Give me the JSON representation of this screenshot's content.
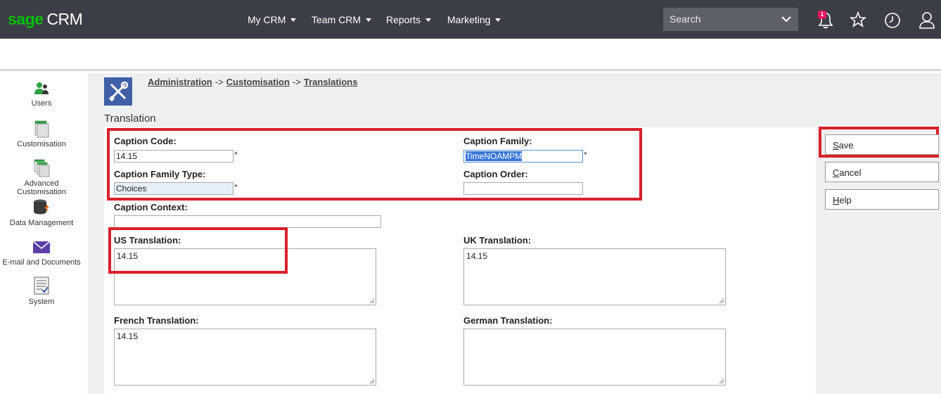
{
  "header": {
    "logo_sage": "sage",
    "logo_crm": "CRM",
    "nav": [
      {
        "label": "My CRM"
      },
      {
        "label": "Team CRM"
      },
      {
        "label": "Reports"
      },
      {
        "label": "Marketing"
      }
    ],
    "search_label": "Search",
    "notification_count": "1"
  },
  "sidebar": {
    "items": [
      {
        "label": "Users"
      },
      {
        "label": "Customisation"
      },
      {
        "label": "Advanced Customisation"
      },
      {
        "label": "Data Management"
      },
      {
        "label": "E-mail and Documents"
      },
      {
        "label": "System"
      }
    ]
  },
  "breadcrumb": {
    "items": [
      "Administration",
      "Customisation",
      "Translations"
    ],
    "separator": "->"
  },
  "section_title": "Translation",
  "form": {
    "caption_code": {
      "label": "Caption Code:",
      "value": "14.15"
    },
    "caption_family": {
      "label": "Caption Family:",
      "value": "TimeNOAMPM"
    },
    "caption_family_type": {
      "label": "Caption Family Type:",
      "value": "Choices"
    },
    "caption_order": {
      "label": "Caption Order:",
      "value": ""
    },
    "caption_context": {
      "label": "Caption Context:",
      "value": ""
    },
    "us_translation": {
      "label": "US Translation:",
      "value": "14.15"
    },
    "uk_translation": {
      "label": "UK Translation:",
      "value": "14.15"
    },
    "french_translation": {
      "label": "French Translation:",
      "value": "14.15"
    },
    "german_translation": {
      "label": "German Translation:",
      "value": ""
    },
    "required_marker": "*"
  },
  "actions": {
    "save_first": "S",
    "save_rest": "ave",
    "cancel_first": "C",
    "cancel_rest": "ancel",
    "help_first": "H",
    "help_rest": "elp"
  },
  "colors": {
    "topbar": "#3b3e47",
    "brand_green": "#00c000",
    "highlight_red": "#d9202b",
    "admin_icon_blue": "#3f5fa7"
  }
}
